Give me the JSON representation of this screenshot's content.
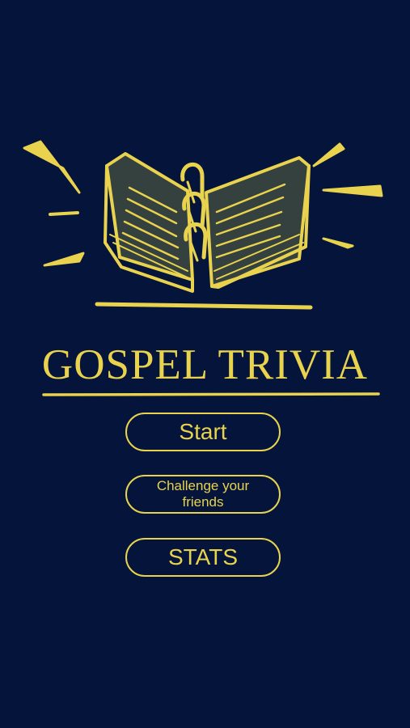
{
  "app": {
    "title": "GOSPEL TRIVIA",
    "logo_icon": "open-bible-sketch-icon"
  },
  "menu": {
    "start_label": "Start",
    "challenge_label": "Challenge your friends",
    "stats_label": "STATS"
  },
  "colors": {
    "background": "#04143a",
    "accent": "#e8d24e",
    "page_fill": "#35413f"
  }
}
